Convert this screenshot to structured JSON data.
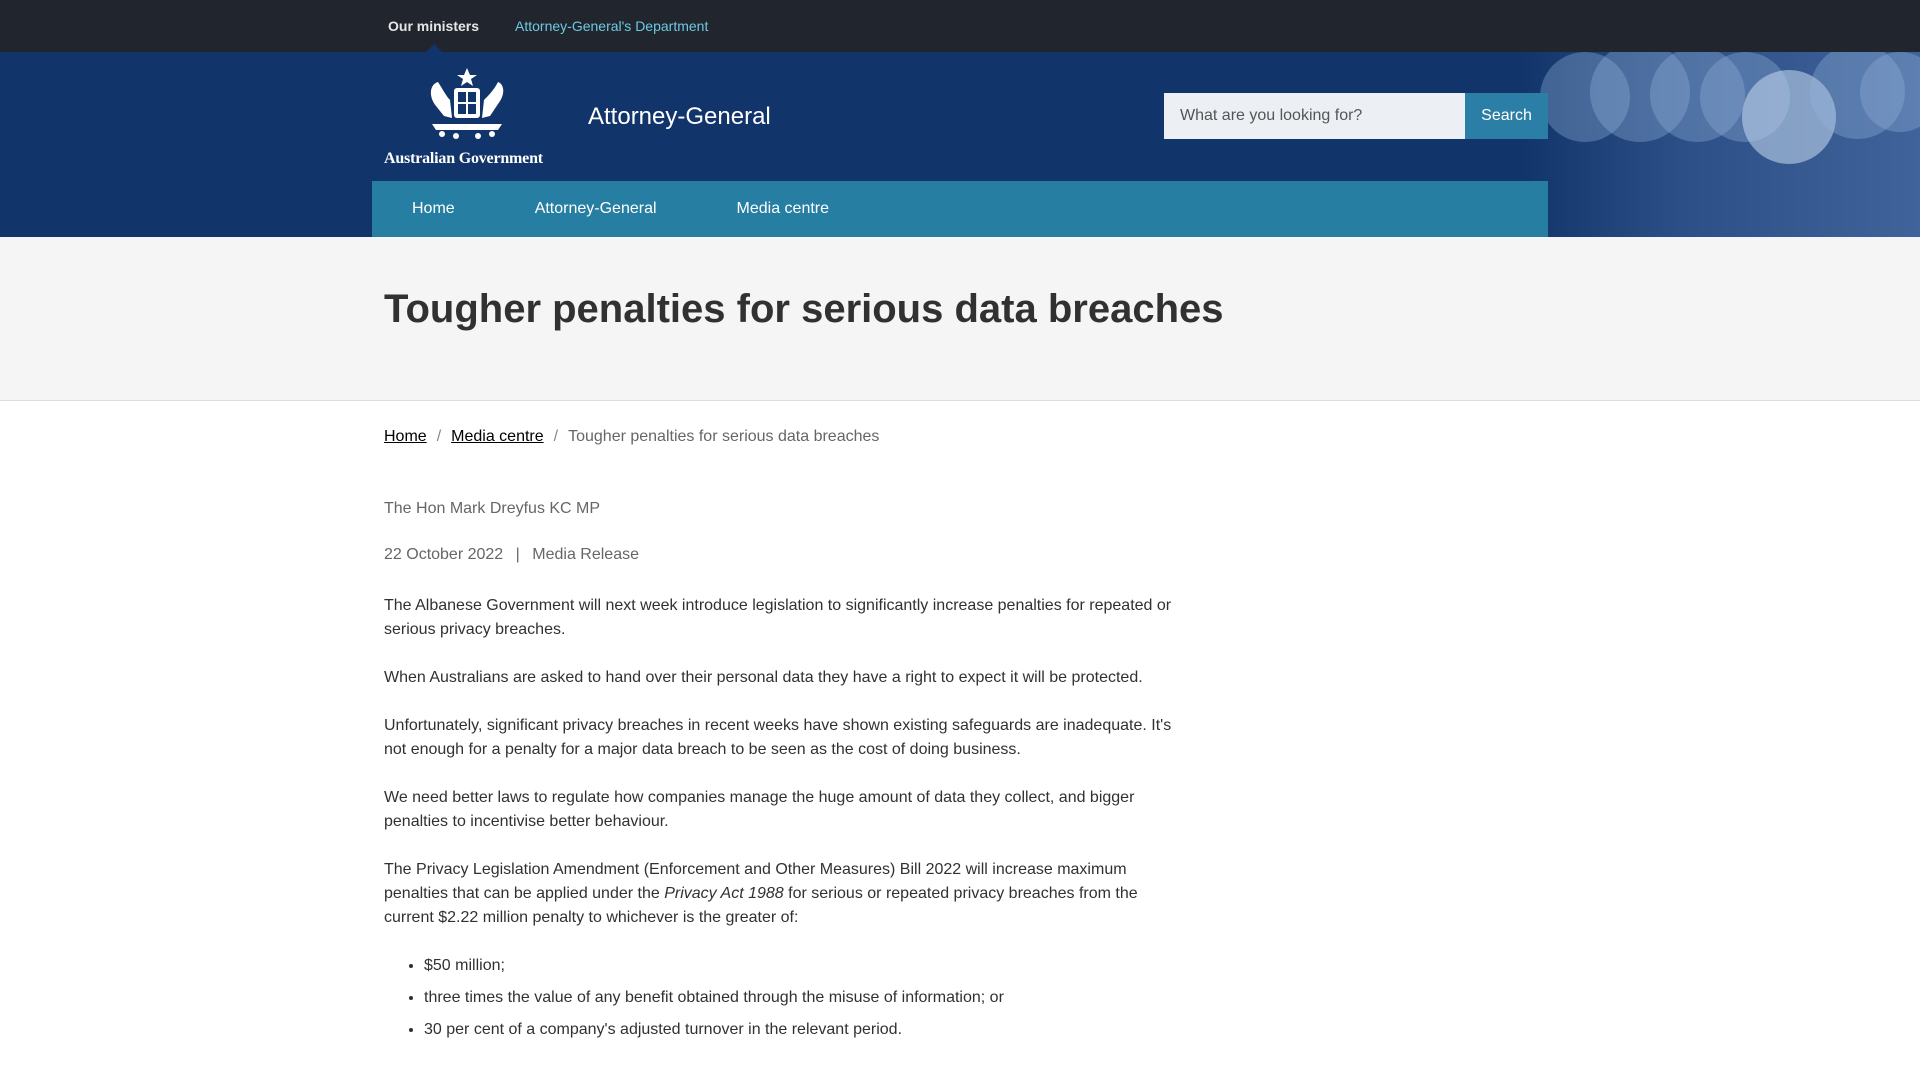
{
  "topbar": {
    "ministers_label": "Our ministers",
    "department_link": "Attorney-General's Department"
  },
  "header": {
    "logo_text": "Australian Government",
    "site_title": "Attorney-General",
    "search_placeholder": "What are you looking for?",
    "search_button": "Search"
  },
  "nav": {
    "items": [
      {
        "label": "Home"
      },
      {
        "label": "Attorney-General"
      },
      {
        "label": "Media centre"
      }
    ]
  },
  "page": {
    "title": "Tougher penalties for serious data breaches",
    "breadcrumb": {
      "home": "Home",
      "media": "Media centre",
      "current": "Tougher penalties for serious data breaches",
      "separator": "/"
    },
    "author": "The Hon Mark Dreyfus KC MP",
    "date": "22 October 2022",
    "date_separator": "|",
    "type": "Media Release"
  },
  "article": {
    "p1": "The Albanese Government will next week introduce legislation to significantly increase penalties for repeated or serious privacy breaches.",
    "p2": "When Australians are asked to hand over their personal data they have a right to expect it will be protected.",
    "p3": "Unfortunately, significant privacy breaches in recent weeks have shown existing safeguards are inadequate. It's not enough for a penalty for a major data breach to be seen as the cost of doing business.",
    "p4": "We need better laws to regulate how companies manage the huge amount of data they collect, and bigger penalties to incentivise better behaviour.",
    "p5_before": "The Privacy Legislation Amendment (Enforcement and Other Measures) Bill 2022 will increase maximum penalties that can be applied under the ",
    "p5_italic": "Privacy Act 1988",
    "p5_after": " for serious or repeated privacy breaches from the current $2.22 million penalty to whichever is the greater of:",
    "bullets": [
      "$50 million;",
      "three times the value of any benefit obtained through the misuse of information; or",
      "30 per cent of a company's adjusted turnover in the relevant period."
    ]
  },
  "colors": {
    "topbar": "#21262e",
    "header": "#11356b",
    "nav": "#267ea3",
    "accent_link": "#6ec8e3"
  }
}
